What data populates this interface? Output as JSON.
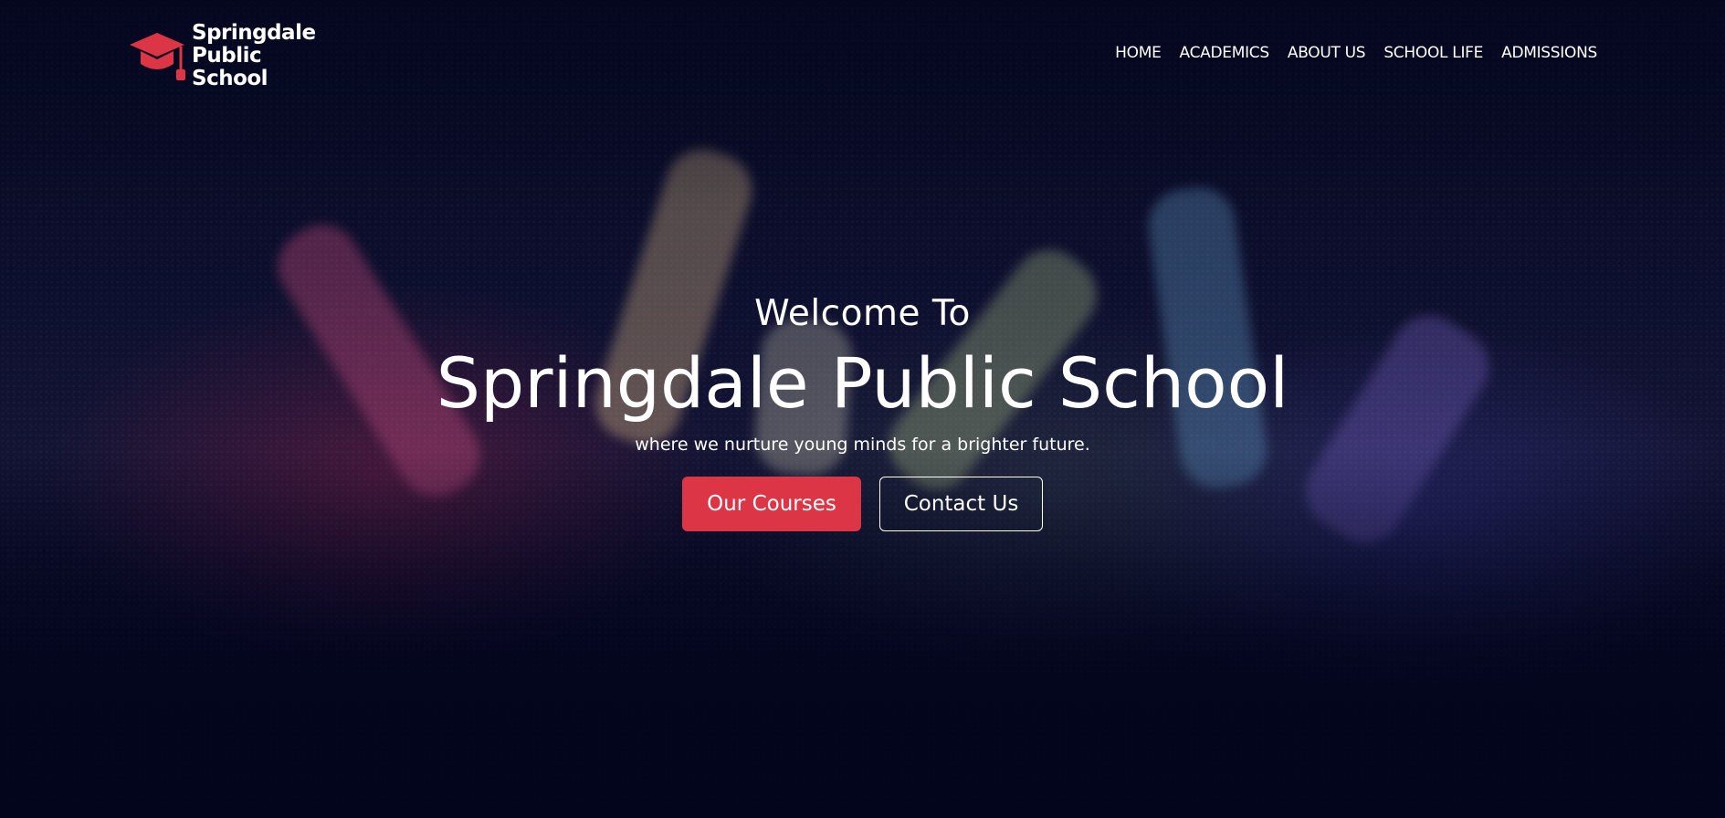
{
  "brand": {
    "line1": "Springdale",
    "line2": "Public",
    "line3": "School",
    "icon": "graduation-cap-icon",
    "accent_color": "#dc3545"
  },
  "nav": {
    "items": [
      {
        "label": "HOME"
      },
      {
        "label": "ACADEMICS"
      },
      {
        "label": "ABOUT US"
      },
      {
        "label": "SCHOOL LIFE"
      },
      {
        "label": "ADMISSIONS"
      }
    ]
  },
  "hero": {
    "welcome": "Welcome To",
    "title": "Springdale Public School",
    "tagline": "where we nurture young minds for a brighter future.",
    "primary_button": "Our Courses",
    "secondary_button": "Contact Us"
  },
  "colors": {
    "background": "#050823",
    "primary_button": "#dc3545",
    "text": "#ffffff"
  }
}
